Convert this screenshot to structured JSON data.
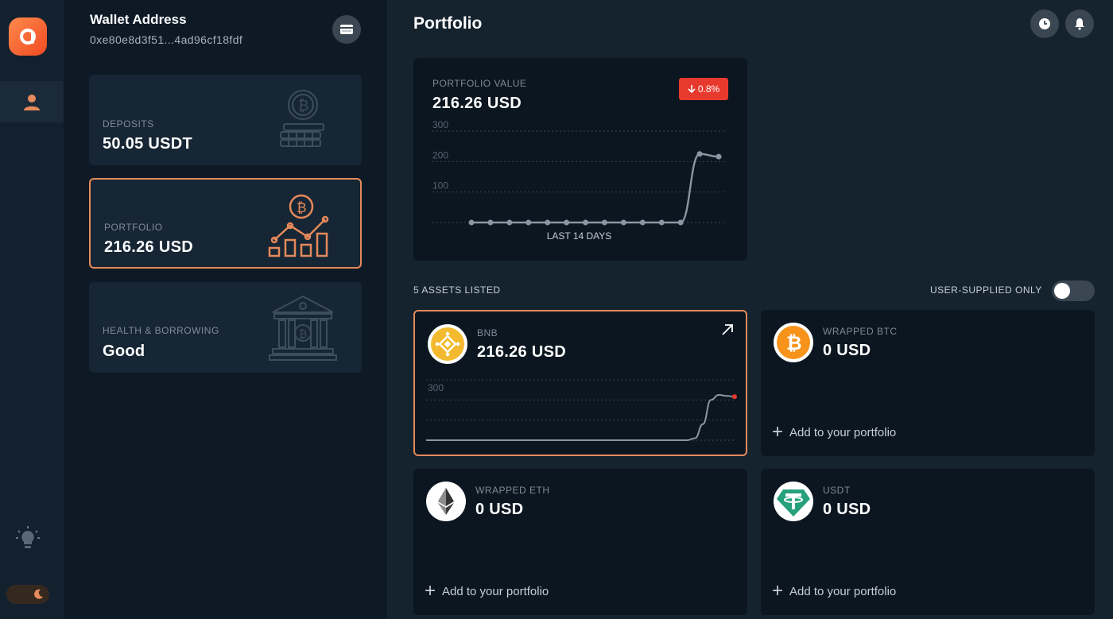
{
  "wallet": {
    "title": "Wallet Address",
    "address": "0xe80e8d3f51...4ad96cf18fdf"
  },
  "cards": [
    {
      "label": "DEPOSITS",
      "value": "50.05 USDT"
    },
    {
      "label": "PORTFOLIO",
      "value": "216.26 USD"
    },
    {
      "label": "HEALTH & BORROWING",
      "value": "Good"
    }
  ],
  "header": {
    "title": "Portfolio"
  },
  "portfolio_value": {
    "label": "PORTFOLIO VALUE",
    "value": "216.26 USD",
    "change": "0.8%",
    "range_label": "LAST 14 DAYS"
  },
  "assets_header": {
    "count_label": "5 ASSETS LISTED",
    "filter_label": "USER-SUPPLIED ONLY",
    "filter_on": false
  },
  "assets": [
    {
      "name": "BNB",
      "value": "216.26 USD"
    },
    {
      "name": "WRAPPED BTC",
      "value": "0 USD",
      "add_label": "Add to your portfolio"
    },
    {
      "name": "WRAPPED ETH",
      "value": "0 USD",
      "add_label": "Add to your portfolio"
    },
    {
      "name": "USDT",
      "value": "0 USD",
      "add_label": "Add to your portfolio"
    }
  ],
  "colors": {
    "accent": "#e58a5a",
    "negative": "#e8392e",
    "bnb": "#f3ba2f",
    "btc": "#f7931a",
    "usdt": "#26a17b"
  },
  "chart_data": [
    {
      "type": "line",
      "x": [
        1,
        2,
        3,
        4,
        5,
        6,
        7,
        8,
        9,
        10,
        11,
        12,
        13,
        14
      ],
      "series": [
        {
          "values": [
            0,
            0,
            0,
            0,
            0,
            0,
            0,
            0,
            0,
            0,
            0,
            0,
            225,
            216.26
          ]
        }
      ],
      "xlabel": "LAST 14 DAYS",
      "yticks": [
        100,
        200,
        300
      ],
      "ylim": [
        0,
        300
      ]
    },
    {
      "type": "line",
      "series": [
        {
          "values": [
            0,
            0,
            0,
            0,
            0,
            0,
            0,
            0,
            0,
            0,
            0,
            0,
            0,
            0,
            0,
            0,
            0,
            0,
            0,
            0,
            0,
            0,
            0,
            0,
            0,
            0,
            0,
            0,
            0,
            0,
            0,
            0,
            0,
            0,
            10,
            80,
            200,
            225,
            220,
            216.26
          ]
        }
      ],
      "yticks": [
        300
      ],
      "ylim": [
        0,
        300
      ]
    }
  ]
}
